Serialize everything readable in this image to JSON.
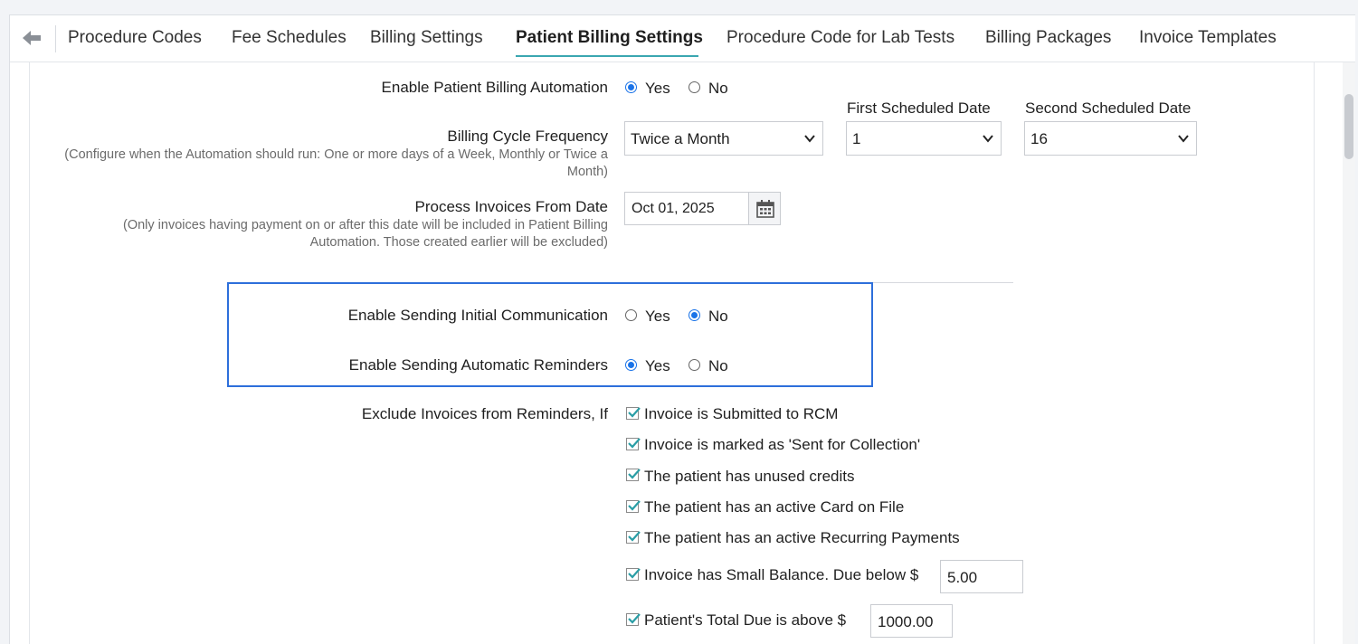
{
  "tabs": [
    {
      "label": "Procedure Codes"
    },
    {
      "label": "Fee Schedules"
    },
    {
      "label": "Billing Settings"
    },
    {
      "label": "Patient Billing Settings",
      "active": true
    },
    {
      "label": "Procedure Code for Lab Tests"
    },
    {
      "label": "Billing Packages"
    },
    {
      "label": "Invoice Templates"
    }
  ],
  "form": {
    "automation": {
      "label": "Enable Patient Billing Automation",
      "yes": "Yes",
      "no": "No",
      "selected": "Yes"
    },
    "cycle": {
      "label": "Billing Cycle Frequency",
      "hint": "(Configure when the Automation should run: One or more days of a Week, Monthly or Twice a Month)",
      "value": "Twice a Month",
      "first_label": "First Scheduled Date",
      "first_value": "1",
      "second_label": "Second Scheduled Date",
      "second_value": "16"
    },
    "from_date": {
      "label": "Process Invoices From Date",
      "hint": "(Only invoices having payment on or after this date will be included in Patient Billing Automation. Those created earlier will be excluded)",
      "value": "Oct 01, 2025"
    },
    "initial_comm": {
      "label": "Enable Sending Initial Communication",
      "yes": "Yes",
      "no": "No",
      "selected": "No"
    },
    "reminders": {
      "label": "Enable Sending Automatic Reminders",
      "yes": "Yes",
      "no": "No",
      "selected": "Yes"
    },
    "exclude": {
      "label": "Exclude Invoices from Reminders, If",
      "items": [
        {
          "text": "Invoice is Submitted to RCM",
          "checked": true
        },
        {
          "text": "Invoice is marked as 'Sent for Collection'",
          "checked": true
        },
        {
          "text": "The patient has unused credits",
          "checked": true
        },
        {
          "text": "The patient has an active Card on File",
          "checked": true
        },
        {
          "text": "The patient has an active Recurring Payments",
          "checked": true
        },
        {
          "text": "Invoice has Small Balance. Due below $",
          "checked": true,
          "input": "5.00"
        },
        {
          "text": "Patient's Total Due is above $",
          "checked": true,
          "input": "1000.00"
        }
      ]
    }
  },
  "colors": {
    "accent": "#1a73e8",
    "tab_underline": "#3aa6b0",
    "highlight_border": "#2d6fdb",
    "check": "#2a9ea6"
  }
}
